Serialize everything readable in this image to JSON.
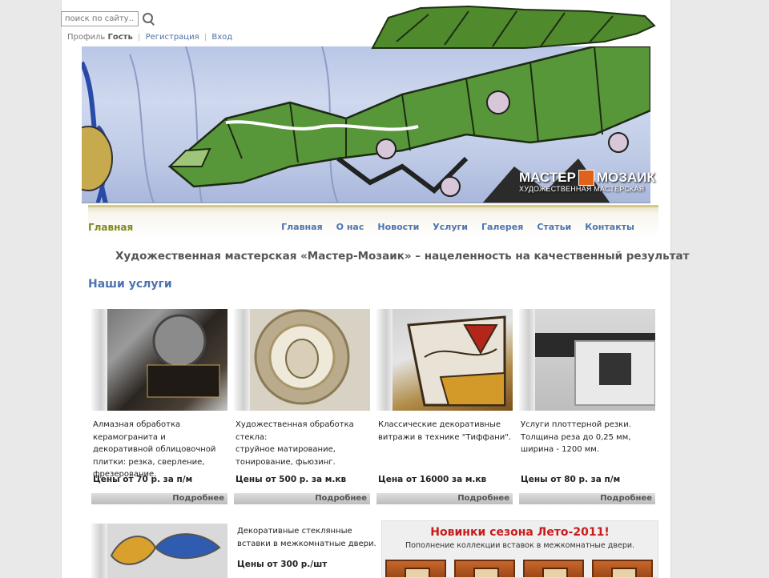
{
  "search": {
    "placeholder": "поиск по сайту..."
  },
  "user_bar": {
    "profile_label": "Профиль",
    "user_name": "Гость",
    "register_label": "Регистрация",
    "login_label": "Вход"
  },
  "logo": {
    "name_left": "МАСТЕР",
    "name_right": "МОЗАИК",
    "subtitle": "ХУДОЖЕСТВЕННАЯ МАСТЕРСКАЯ"
  },
  "nav": {
    "current": "Главная",
    "items": [
      "Главная",
      "О нас",
      "Новости",
      "Услуги",
      "Галерея",
      "Статьи",
      "Контакты"
    ]
  },
  "slogan": "Художественная мастерская «Мастер-Мозаик» – нацеленность на качественный результат",
  "services_title": "Наши услуги",
  "services": [
    {
      "desc": "Алмазная обработка керамогранита и декоративной облицовочной плитки: резка, сверление, фрезерование.",
      "price": "Цены от 70 р. за п/м",
      "more": "Подробнее"
    },
    {
      "desc": "Художественная обработка стекла:\nструйное матирование, тонирование, фьюзинг.",
      "price": "Цены от 500 р. за м.кв",
      "more": "Подробнее"
    },
    {
      "desc": "Классические декоративные витражи в технике \"Тиффани\".",
      "price": "Цена от 16000 за м.кв",
      "more": "Подробнее"
    },
    {
      "desc": "Услуги плоттерной резки. Толщина реза до 0,25 мм, ширина - 1200 мм.",
      "price": "Цены от 80 р. за п/м",
      "more": "Подробнее"
    }
  ],
  "bottom_service": {
    "desc": "Декоративные стеклянные вставки в межкомнатные двери.",
    "price": "Цены от 300 р./шт"
  },
  "promo": {
    "title": "Новинки сезона Лето-2011!",
    "subtitle": "Пополнение коллекции вставок в межкомнатные двери."
  },
  "colors": {
    "nav_link": "#4d74b1",
    "nav_current": "#7e8a1c",
    "promo_title": "#c91b1b"
  }
}
